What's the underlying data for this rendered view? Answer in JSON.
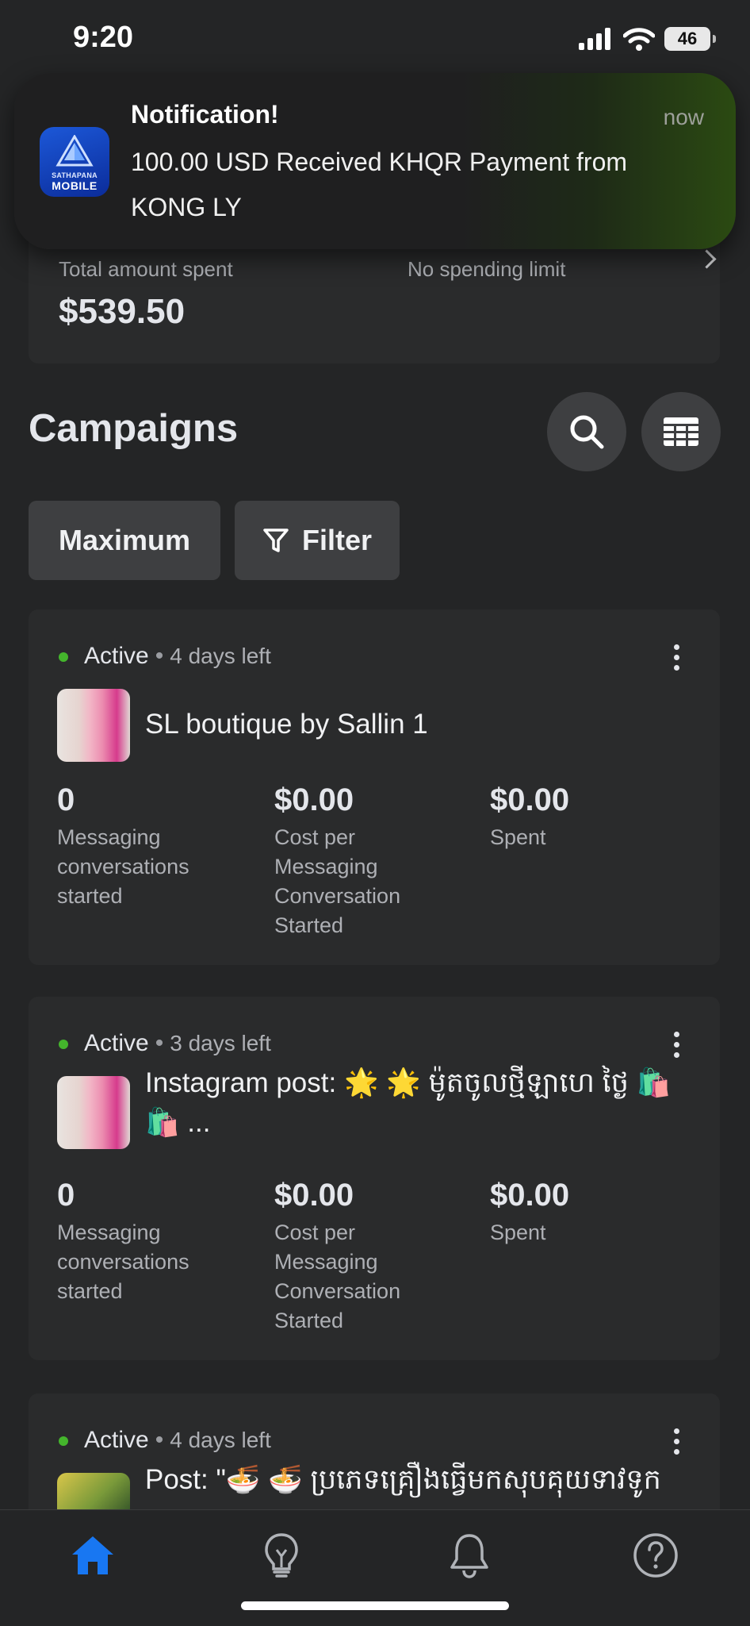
{
  "status_bar": {
    "time": "9:20",
    "battery": "46"
  },
  "notification": {
    "app_name_small": "SATHAPANA",
    "app_name": "MOBILE",
    "title": "Notification!",
    "time": "now",
    "body": "100.00 USD Received KHQR Payment from KONG LY"
  },
  "spend_summary": {
    "total_label": "Total amount spent",
    "total_value": "$539.50",
    "limit_label": "No spending limit"
  },
  "campaigns": {
    "title": "Campaigns",
    "sort_label": "Maximum",
    "filter_label": "Filter",
    "items": [
      {
        "status": "Active",
        "time_left": "4 days left",
        "name": "SL boutique by Sallin 1",
        "metrics": [
          {
            "value": "0",
            "label": "Messaging conversations started"
          },
          {
            "value": "$0.00",
            "label": "Cost per Messaging Conversation Started"
          },
          {
            "value": "$0.00",
            "label": "Spent"
          }
        ]
      },
      {
        "status": "Active",
        "time_left": "3 days left",
        "name": "Instagram post: 🌟 🌟 ម៉ូតចូលថ្មីឡាហេ ថ្ងៃ 🛍️ 🛍️ ...",
        "metrics": [
          {
            "value": "0",
            "label": "Messaging conversations started"
          },
          {
            "value": "$0.00",
            "label": "Cost per Messaging Conversation Started"
          },
          {
            "value": "$0.00",
            "label": "Spent"
          }
        ]
      },
      {
        "status": "Active",
        "time_left": "4 days left",
        "name": "Post: \"🍜 🍜 ប្រភេទគ្រឿងធ្វើមកសុបគុយទាវទូក"
      }
    ]
  },
  "bottom_nav": {
    "items": [
      "home-icon",
      "lightbulb-icon",
      "bell-icon",
      "help-icon"
    ],
    "active_color": "#1877f2"
  }
}
